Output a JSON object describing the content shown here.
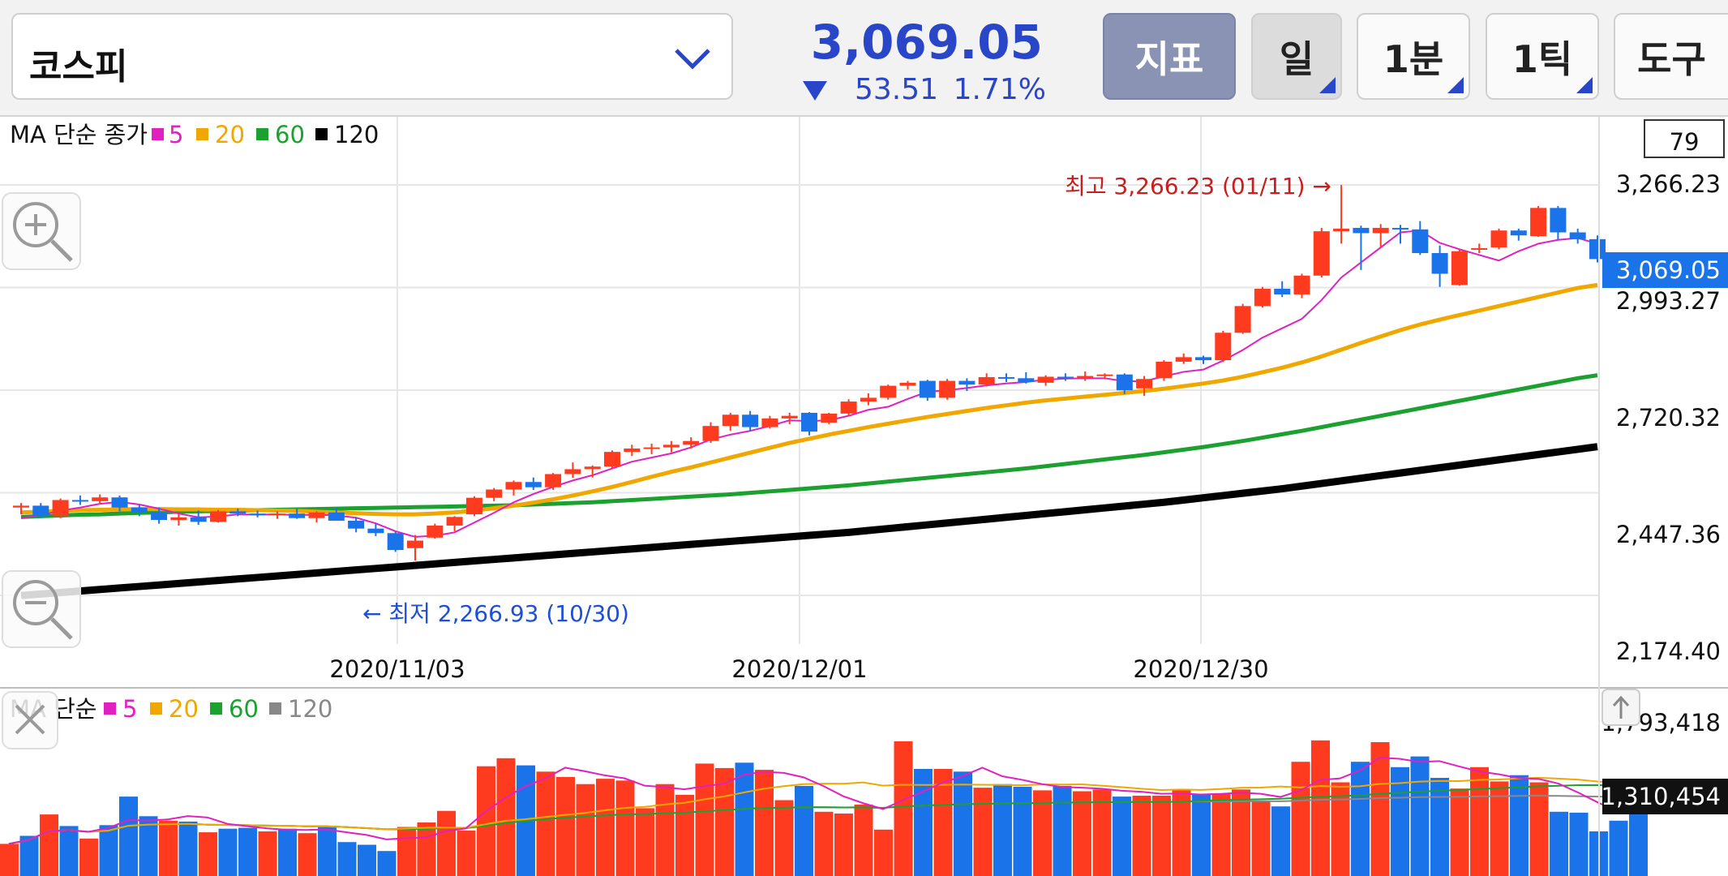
{
  "header": {
    "symbol": "코스피",
    "price": "3,069.05",
    "change": "53.51",
    "change_pct": "1.71%",
    "buttons": {
      "indicator": "지표",
      "day": "일",
      "one_min": "1분",
      "one_tick": "1틱",
      "tools": "도구"
    }
  },
  "colors": {
    "up": "#ff3b1f",
    "down": "#1a73e8",
    "ma5": "#e020c0",
    "ma20": "#f0a800",
    "ma60": "#1ca030",
    "ma120": "#000000",
    "ma120_vol": "#888888"
  },
  "price_panel": {
    "legend": {
      "title": "MA 단순 종가",
      "ma5": "5",
      "ma20": "20",
      "ma60": "60",
      "ma120": "120"
    },
    "count_box": "79",
    "y_ticks": [
      "3,266.23",
      "2,993.27",
      "2,720.32",
      "2,447.36",
      "2,174.40"
    ],
    "current_label": "3,069.05",
    "high_label": "최고 3,266.23 (01/11) →",
    "low_label": "← 최저 2,266.93 (10/30)",
    "x_labels": [
      "2020/11/03",
      "2020/12/01",
      "2020/12/30"
    ]
  },
  "volume_panel": {
    "legend": {
      "title": "MA 단순",
      "ma5": "5",
      "ma20": "20",
      "ma60": "60",
      "ma120": "120"
    },
    "y_top": "1,793,418",
    "current_label": "1,310,454"
  },
  "chart_data": {
    "type": "candlestick",
    "title": "",
    "ylim": [
      2174.4,
      3266.23
    ],
    "candles": [
      [
        2408,
        2420,
        2390,
        2413
      ],
      [
        2413,
        2420,
        2380,
        2385
      ],
      [
        2385,
        2432,
        2380,
        2428
      ],
      [
        2428,
        2440,
        2415,
        2425
      ],
      [
        2425,
        2443,
        2420,
        2435
      ],
      [
        2435,
        2440,
        2398,
        2408
      ],
      [
        2408,
        2415,
        2385,
        2395
      ],
      [
        2395,
        2408,
        2365,
        2375
      ],
      [
        2375,
        2390,
        2360,
        2382
      ],
      [
        2382,
        2400,
        2362,
        2370
      ],
      [
        2370,
        2402,
        2368,
        2398
      ],
      [
        2398,
        2405,
        2385,
        2392
      ],
      [
        2392,
        2400,
        2382,
        2388
      ],
      [
        2388,
        2398,
        2378,
        2392
      ],
      [
        2392,
        2405,
        2378,
        2380
      ],
      [
        2380,
        2398,
        2368,
        2395
      ],
      [
        2395,
        2408,
        2380,
        2373
      ],
      [
        2373,
        2382,
        2342,
        2352
      ],
      [
        2352,
        2365,
        2332,
        2340
      ],
      [
        2340,
        2345,
        2290,
        2295
      ],
      [
        2300,
        2335,
        2267,
        2320
      ],
      [
        2328,
        2365,
        2325,
        2360
      ],
      [
        2360,
        2385,
        2345,
        2383
      ],
      [
        2390,
        2438,
        2385,
        2434
      ],
      [
        2434,
        2460,
        2425,
        2456
      ],
      [
        2456,
        2480,
        2440,
        2476
      ],
      [
        2476,
        2488,
        2455,
        2462
      ],
      [
        2462,
        2500,
        2455,
        2497
      ],
      [
        2497,
        2528,
        2487,
        2510
      ],
      [
        2510,
        2520,
        2488,
        2517
      ],
      [
        2517,
        2560,
        2510,
        2556
      ],
      [
        2556,
        2575,
        2545,
        2565
      ],
      [
        2565,
        2578,
        2550,
        2568
      ],
      [
        2568,
        2585,
        2555,
        2575
      ],
      [
        2575,
        2595,
        2565,
        2585
      ],
      [
        2585,
        2635,
        2580,
        2625
      ],
      [
        2625,
        2660,
        2612,
        2655
      ],
      [
        2655,
        2665,
        2610,
        2622
      ],
      [
        2622,
        2652,
        2618,
        2645
      ],
      [
        2645,
        2660,
        2630,
        2652
      ],
      [
        2660,
        2662,
        2600,
        2610
      ],
      [
        2634,
        2660,
        2630,
        2658
      ],
      [
        2658,
        2696,
        2650,
        2690
      ],
      [
        2690,
        2712,
        2680,
        2700
      ],
      [
        2700,
        2735,
        2695,
        2732
      ],
      [
        2732,
        2745,
        2722,
        2740
      ],
      [
        2745,
        2748,
        2692,
        2700
      ],
      [
        2700,
        2750,
        2695,
        2745
      ],
      [
        2745,
        2752,
        2718,
        2735
      ],
      [
        2735,
        2765,
        2730,
        2755
      ],
      [
        2755,
        2765,
        2742,
        2752
      ],
      [
        2752,
        2768,
        2738,
        2742
      ],
      [
        2740,
        2760,
        2732,
        2756
      ],
      [
        2756,
        2765,
        2745,
        2752
      ],
      [
        2752,
        2770,
        2745,
        2758
      ],
      [
        2758,
        2765,
        2750,
        2762
      ],
      [
        2762,
        2765,
        2710,
        2720
      ],
      [
        2725,
        2758,
        2705,
        2750
      ],
      [
        2752,
        2800,
        2745,
        2796
      ],
      [
        2796,
        2818,
        2790,
        2808
      ],
      [
        2808,
        2812,
        2790,
        2800
      ],
      [
        2800,
        2878,
        2795,
        2873
      ],
      [
        2873,
        2950,
        2870,
        2944
      ],
      [
        2944,
        2995,
        2940,
        2990
      ],
      [
        2990,
        3010,
        2968,
        2975
      ],
      [
        2975,
        3030,
        2965,
        3025
      ],
      [
        3025,
        3152,
        3020,
        3143
      ],
      [
        3143,
        3266,
        3110,
        3150
      ],
      [
        3152,
        3158,
        3040,
        3138
      ],
      [
        3138,
        3162,
        3100,
        3152
      ],
      [
        3152,
        3160,
        3110,
        3148
      ],
      [
        3148,
        3170,
        3080,
        3085
      ],
      [
        3085,
        3105,
        2995,
        3030
      ],
      [
        3000,
        3095,
        2998,
        3090
      ],
      [
        3095,
        3110,
        3085,
        3098
      ],
      [
        3100,
        3150,
        3095,
        3145
      ],
      [
        3145,
        3150,
        3118,
        3132
      ],
      [
        3130,
        3210,
        3128,
        3205
      ],
      [
        3205,
        3210,
        3120,
        3140
      ],
      [
        3140,
        3150,
        3110,
        3122
      ],
      [
        3122,
        3132,
        3060,
        3069
      ]
    ],
    "ma5": [
      2380,
      2388,
      2400,
      2408,
      2418,
      2423,
      2416,
      2405,
      2392,
      2382,
      2384,
      2390,
      2389,
      2390,
      2388,
      2389,
      2387,
      2381,
      2366,
      2345,
      2330,
      2333,
      2342,
      2368,
      2394,
      2422,
      2444,
      2463,
      2480,
      2494,
      2512,
      2530,
      2541,
      2552,
      2568,
      2589,
      2602,
      2612,
      2625,
      2640,
      2638,
      2640,
      2652,
      2668,
      2676,
      2697,
      2716,
      2720,
      2726,
      2733,
      2738,
      2742,
      2748,
      2751,
      2752,
      2752,
      2744,
      2744,
      2757,
      2769,
      2775,
      2799,
      2827,
      2860,
      2885,
      2910,
      2960,
      3020,
      3060,
      3100,
      3140,
      3145,
      3112,
      3095,
      3080,
      3065,
      3090,
      3110,
      3120,
      3125,
      3110
    ],
    "ma20": [
      2395,
      2397,
      2399,
      2401,
      2402,
      2403,
      2404,
      2404,
      2403,
      2403,
      2402,
      2402,
      2401,
      2400,
      2399,
      2397,
      2395,
      2393,
      2391,
      2390,
      2390,
      2392,
      2395,
      2400,
      2406,
      2413,
      2421,
      2430,
      2440,
      2451,
      2463,
      2476,
      2490,
      2503,
      2515,
      2528,
      2541,
      2554,
      2567,
      2580,
      2591,
      2602,
      2612,
      2622,
      2631,
      2640,
      2649,
      2657,
      2665,
      2673,
      2680,
      2687,
      2693,
      2698,
      2703,
      2708,
      2713,
      2718,
      2724,
      2731,
      2738,
      2746,
      2756,
      2768,
      2780,
      2794,
      2810,
      2828,
      2846,
      2863,
      2880,
      2895,
      2908,
      2920,
      2932,
      2944,
      2956,
      2968,
      2980,
      2992,
      3000
    ],
    "ma60": [
      2383,
      2385,
      2387,
      2389,
      2390,
      2392,
      2394,
      2395,
      2397,
      2398,
      2399,
      2400,
      2401,
      2402,
      2403,
      2404,
      2405,
      2406,
      2407,
      2408,
      2409,
      2410,
      2411,
      2412,
      2413,
      2414,
      2416,
      2418,
      2420,
      2422,
      2425,
      2428,
      2431,
      2434,
      2437,
      2440,
      2443,
      2447,
      2451,
      2455,
      2459,
      2463,
      2467,
      2472,
      2477,
      2482,
      2487,
      2492,
      2497,
      2502,
      2507,
      2512,
      2518,
      2524,
      2530,
      2536,
      2542,
      2548,
      2555,
      2562,
      2569,
      2577,
      2585,
      2594,
      2603,
      2612,
      2622,
      2632,
      2642,
      2652,
      2662,
      2672,
      2682,
      2692,
      2702,
      2712,
      2722,
      2732,
      2742,
      2752,
      2760
    ],
    "ma120": [
      2174,
      2178,
      2182,
      2186,
      2190,
      2194,
      2198,
      2202,
      2206,
      2210,
      2214,
      2218,
      2222,
      2226,
      2230,
      2234,
      2238,
      2242,
      2246,
      2250,
      2254,
      2258,
      2262,
      2266,
      2270,
      2274,
      2278,
      2282,
      2286,
      2290,
      2294,
      2298,
      2302,
      2306,
      2310,
      2314,
      2318,
      2322,
      2326,
      2330,
      2334,
      2338,
      2342,
      2347,
      2352,
      2357,
      2362,
      2367,
      2372,
      2377,
      2382,
      2387,
      2392,
      2397,
      2402,
      2407,
      2412,
      2417,
      2422,
      2428,
      2434,
      2440,
      2446,
      2452,
      2458,
      2465,
      2472,
      2479,
      2486,
      2493,
      2500,
      2507,
      2514,
      2521,
      2528,
      2535,
      2542,
      2549,
      2556,
      2563,
      2570
    ],
    "volume": [
      1180,
      1225,
      1345,
      1280,
      1210,
      1285,
      1445,
      1335,
      1310,
      1305,
      1245,
      1265,
      1270,
      1250,
      1265,
      1240,
      1280,
      1190,
      1175,
      1140,
      1275,
      1300,
      1365,
      1255,
      1615,
      1660,
      1620,
      1585,
      1555,
      1515,
      1545,
      1535,
      1380,
      1515,
      1455,
      1630,
      1605,
      1635,
      1595,
      1425,
      1505,
      1360,
      1350,
      1400,
      1260,
      1755,
      1600,
      1600,
      1585,
      1495,
      1515,
      1500,
      1480,
      1505,
      1475,
      1485,
      1445,
      1450,
      1450,
      1480,
      1460,
      1460,
      1485,
      1420,
      1390,
      1640,
      1760,
      1525,
      1640,
      1750,
      1610,
      1670,
      1550,
      1490,
      1610,
      1530,
      1565,
      1525,
      1360,
      1355,
      1250,
      1310,
      1545
    ],
    "vol_ylim": [
      1000,
      1800
    ]
  }
}
